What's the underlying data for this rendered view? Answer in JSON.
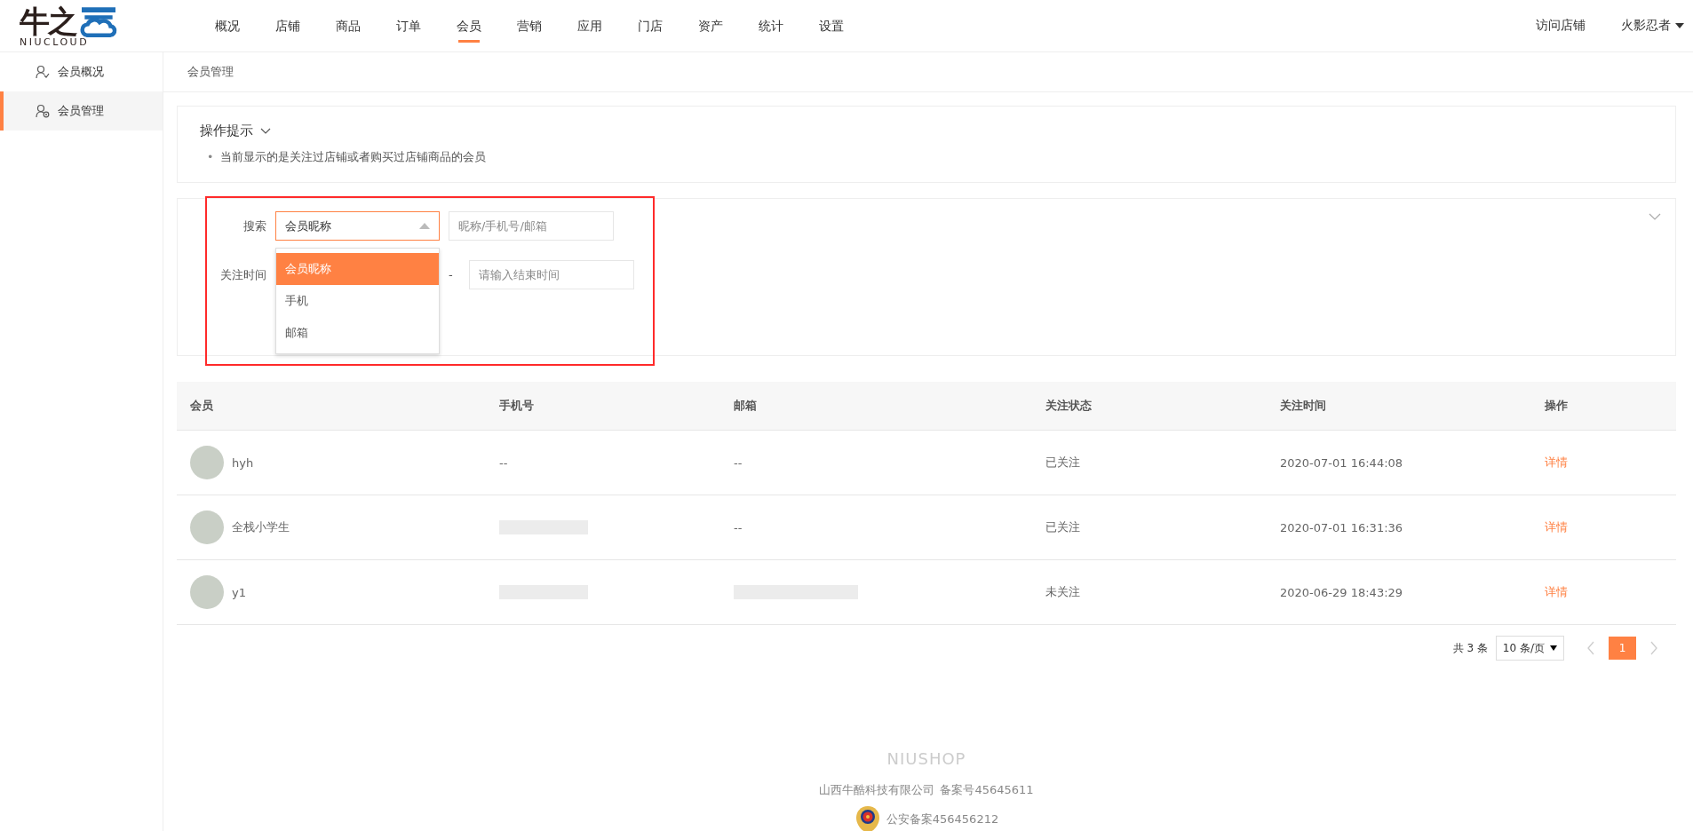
{
  "logo": {
    "mark": "牛之",
    "wordmark": "NIUCLOUD"
  },
  "nav": [
    {
      "label": "概况",
      "selected": false
    },
    {
      "label": "店铺",
      "selected": false
    },
    {
      "label": "商品",
      "selected": false
    },
    {
      "label": "订单",
      "selected": false
    },
    {
      "label": "会员",
      "selected": true
    },
    {
      "label": "营销",
      "selected": false
    },
    {
      "label": "应用",
      "selected": false
    },
    {
      "label": "门店",
      "selected": false
    },
    {
      "label": "资产",
      "selected": false
    },
    {
      "label": "统计",
      "selected": false
    },
    {
      "label": "设置",
      "selected": false
    }
  ],
  "header_links": {
    "visit_store": "访问店铺",
    "user": "火影忍者"
  },
  "sidebar": {
    "items": [
      {
        "label": "会员概况",
        "kind": "overview",
        "selected": false
      },
      {
        "label": "会员管理",
        "kind": "manage",
        "selected": true
      }
    ]
  },
  "breadcrumb": "会员管理",
  "tips": {
    "title": "操作提示",
    "bullet": "•",
    "items": [
      "当前显示的是关注过店铺或者购买过店铺商品的会员"
    ]
  },
  "filter": {
    "search_label": "搜索",
    "search_select": {
      "value": "会员昵称",
      "options": [
        {
          "label": "会员昵称",
          "selected": true
        },
        {
          "label": "手机",
          "selected": false
        },
        {
          "label": "邮箱",
          "selected": false
        }
      ]
    },
    "search_input": {
      "placeholder": "昵称/手机号/邮箱"
    },
    "time_label": "关注时间",
    "time_separator": "-",
    "end_time": {
      "placeholder": "请输入结束时间"
    }
  },
  "table": {
    "columns": [
      "会员",
      "手机号",
      "邮箱",
      "关注状态",
      "关注时间",
      "操作"
    ],
    "rows": [
      {
        "name": "hyh",
        "phone": {
          "kind": "text",
          "text": "--"
        },
        "email": {
          "kind": "text",
          "text": "--"
        },
        "status": "已关注",
        "time": "2020-07-01 16:44:08",
        "action": "详情"
      },
      {
        "name": "全栈小学生",
        "phone": {
          "kind": "blurred"
        },
        "email": {
          "kind": "text",
          "text": "--"
        },
        "status": "已关注",
        "time": "2020-07-01 16:31:36",
        "action": "详情"
      },
      {
        "name": "y1",
        "phone": {
          "kind": "blurred"
        },
        "email": {
          "kind": "blurred"
        },
        "status": "未关注",
        "time": "2020-06-29 18:43:29",
        "action": "详情"
      }
    ]
  },
  "pagination": {
    "total": "共 3 条",
    "page_size": "10 条/页",
    "pages": [
      {
        "label": "1",
        "selected": true
      }
    ]
  },
  "footer": {
    "brand": "NIUSHOP",
    "company": "山西牛酷科技有限公司",
    "icp": "备案号45645611",
    "police": "公安备案456456212"
  }
}
